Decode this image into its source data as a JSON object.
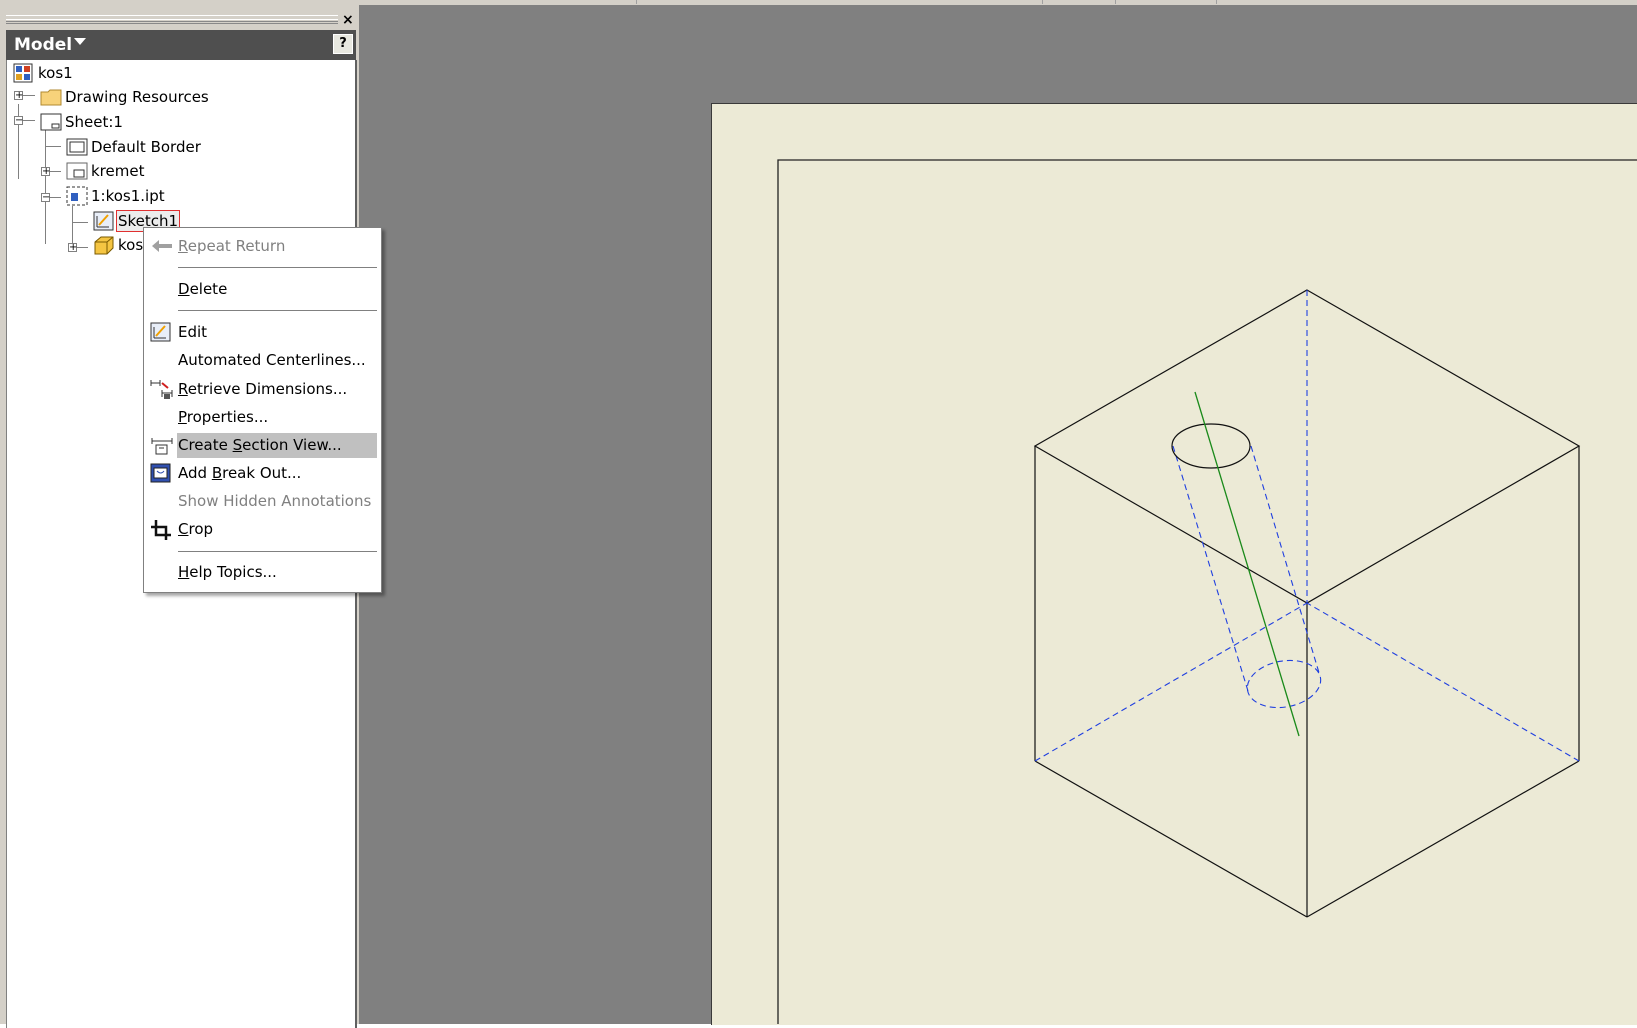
{
  "browser": {
    "title": "Model",
    "help_label": "?",
    "close_label": "×",
    "tree": [
      {
        "label": "kos1"
      },
      {
        "label": "Drawing Resources"
      },
      {
        "label": "Sheet:1"
      },
      {
        "label": "Default Border"
      },
      {
        "label": "kremet"
      },
      {
        "label": "1:kos1.ipt"
      },
      {
        "label": "Sketch1"
      },
      {
        "label": "kos"
      }
    ]
  },
  "context_menu": {
    "items": [
      {
        "label": "Repeat Return",
        "mnemonic": "R",
        "rest": "epeat Return",
        "enabled": false
      },
      {
        "label": "Delete",
        "mnemonic": "D",
        "rest": "elete",
        "enabled": true
      },
      {
        "label": "Edit",
        "enabled": true
      },
      {
        "label": "Automated Centerlines...",
        "enabled": true
      },
      {
        "label": "Retrieve Dimensions...",
        "mnemonic": "R",
        "rest": "etrieve Dimensions...",
        "enabled": true
      },
      {
        "label": "Properties...",
        "mnemonic": "P",
        "rest": "roperties...",
        "enabled": true
      },
      {
        "label": "Create Section View...",
        "pre": "Create ",
        "mnemonic": "S",
        "rest": "ection View...",
        "enabled": true,
        "highlighted": true
      },
      {
        "label": "Add Break Out...",
        "pre": "Add ",
        "mnemonic": "B",
        "rest": "reak Out...",
        "enabled": true
      },
      {
        "label": "Show Hidden Annotations",
        "enabled": false
      },
      {
        "label": "Crop",
        "mnemonic": "C",
        "rest": "rop",
        "enabled": true
      },
      {
        "label": "Help Topics...",
        "mnemonic": "H",
        "rest": "elp Topics...",
        "enabled": true
      }
    ]
  },
  "colors": {
    "panel_header": "#4f4f4f",
    "canvas_bg": "#808080",
    "sheet_bg": "#ecead6",
    "hidden_line": "#1f3fe0",
    "axis_line": "#1a8a1a",
    "menu_highlight": "#c0c0c0"
  }
}
